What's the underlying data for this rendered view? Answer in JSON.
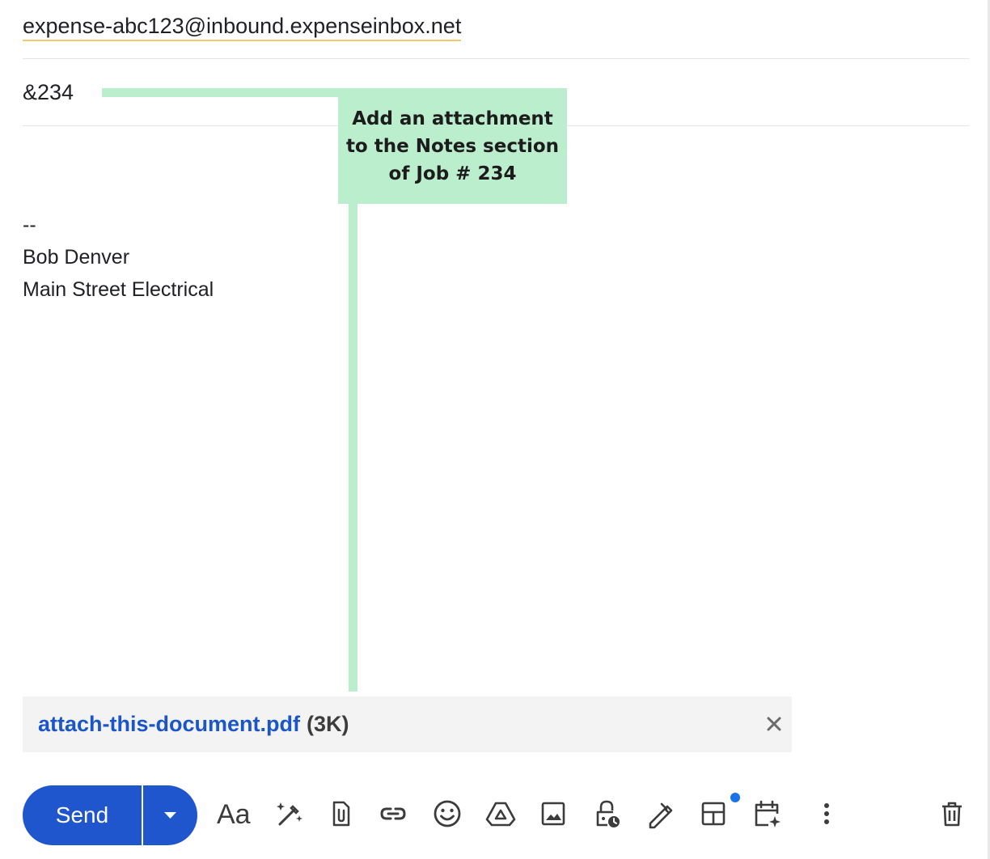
{
  "compose": {
    "to": "expense-abc123@inbound.expenseinbox.net",
    "subject": "&234",
    "signature": [
      "--",
      "Bob Denver",
      "Main Street Electrical"
    ]
  },
  "callout": {
    "lines": [
      "Add an attachment",
      "to the Notes section",
      "of Job # 234"
    ],
    "color": "#bbeecd"
  },
  "attachment": {
    "filename": "attach-this-document.pdf",
    "size": "(3K)"
  },
  "toolbar": {
    "send_label": "Send",
    "send_color": "#1f55cd",
    "format_label": "Aa",
    "icons": [
      "send-options-icon",
      "formatting-icon",
      "ai-write-icon",
      "attach-file-icon",
      "insert-link-icon",
      "emoji-icon",
      "google-drive-icon",
      "insert-photo-icon",
      "confidential-mode-icon",
      "signature-icon",
      "layouts-icon",
      "schedule-icon",
      "more-options-icon",
      "discard-draft-icon"
    ]
  }
}
